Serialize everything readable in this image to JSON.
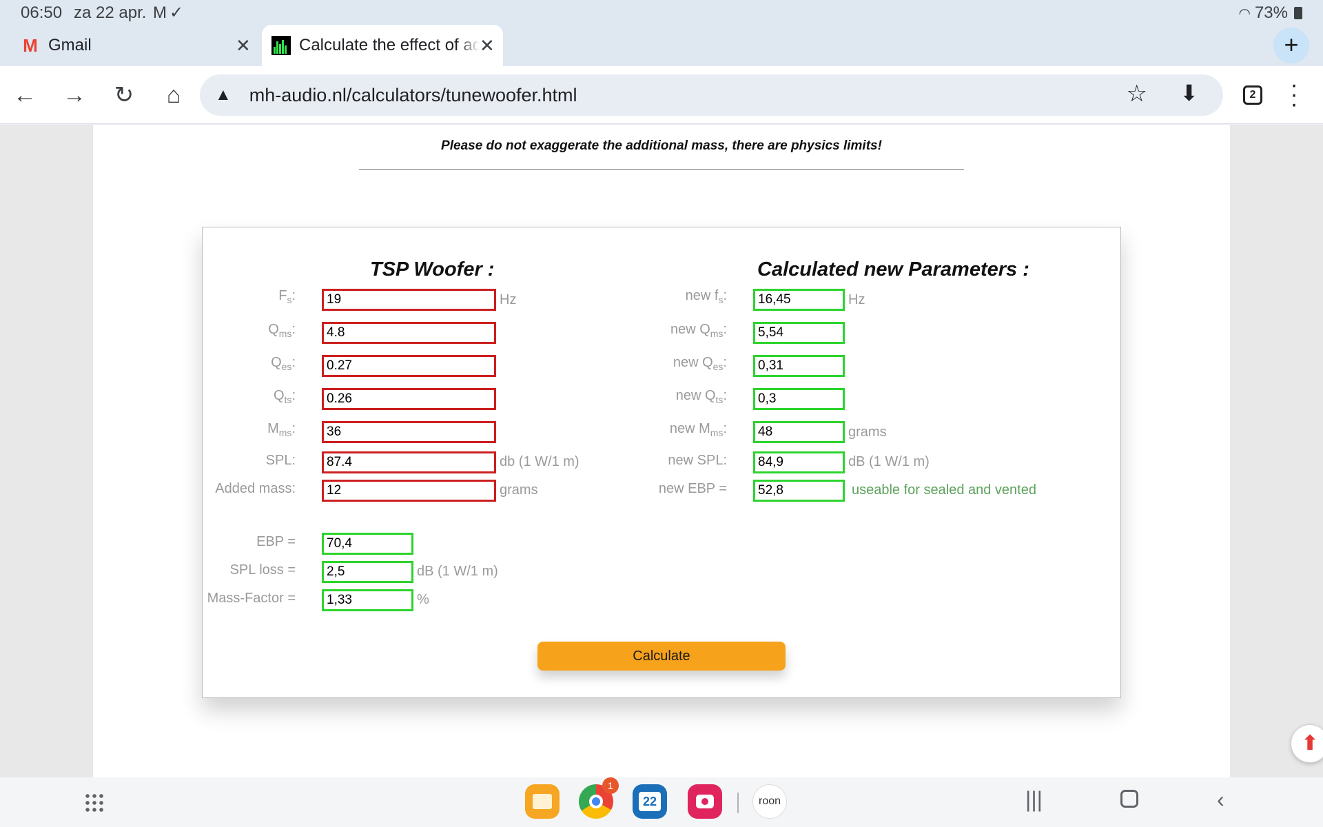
{
  "status_bar": {
    "time": "06:50",
    "date": "za 22 apr.",
    "notification_icons": [
      "gmail-notification-icon",
      "checkmark-icon"
    ],
    "battery": "73%"
  },
  "tabs": [
    {
      "label": "Gmail",
      "active": false,
      "icon": "gmail-icon"
    },
    {
      "label": "Calculate the effect of adding mass",
      "active": true,
      "icon": "graph-icon"
    }
  ],
  "tab_count": "2",
  "address_bar": {
    "url": "mh-audio.nl/calculators/tunewoofer.html"
  },
  "page": {
    "notice": "Please do not exaggerate the additional mass, there are physics limits!",
    "left_title": "TSP Woofer :",
    "right_title": "Calculated new Parameters :",
    "inputs": {
      "fs": {
        "label": "F",
        "sub": "s",
        "value": "19",
        "unit": "Hz"
      },
      "qms": {
        "label": "Q",
        "sub": "ms",
        "value": "4.8"
      },
      "qes": {
        "label": "Q",
        "sub": "es",
        "value": "0.27"
      },
      "qts": {
        "label": "Q",
        "sub": "ts",
        "value": "0.26"
      },
      "mms": {
        "label": "M",
        "sub": "ms",
        "value": "36"
      },
      "spl": {
        "label": "SPL:",
        "value": "87.4",
        "unit": "db (1 W/1 m)"
      },
      "added_mass": {
        "label": "Added mass:",
        "value": "12",
        "unit": "grams"
      }
    },
    "results_left": {
      "ebp": {
        "label": "EBP =",
        "value": "70,4"
      },
      "spl_loss": {
        "label": "SPL loss =",
        "value": "2,5",
        "unit": "dB (1 W/1 m)"
      },
      "mass_factor": {
        "label": "Mass-Factor =",
        "value": "1,33",
        "unit": "%"
      }
    },
    "results_right": {
      "new_fs": {
        "label": "new f",
        "sub": "s",
        "value": "16,45",
        "unit": "Hz"
      },
      "new_qms": {
        "label": "new Q",
        "sub": "ms",
        "value": "5,54"
      },
      "new_qes": {
        "label": "new Q",
        "sub": "es",
        "value": "0,31"
      },
      "new_qts": {
        "label": "new Q",
        "sub": "ts",
        "value": "0,3"
      },
      "new_mms": {
        "label": "new M",
        "sub": "ms",
        "value": "48",
        "unit": "grams"
      },
      "new_spl": {
        "label": "new SPL:",
        "value": "84,9",
        "unit": "dB (1 W/1 m)"
      },
      "new_ebp": {
        "label": "new EBP =",
        "value": "52,8",
        "unit": "useable for sealed and vented"
      }
    },
    "calculate_button": "Calculate"
  },
  "dock": {
    "chrome_badge": "1",
    "calendar_day": "22",
    "roon_label": "roon"
  },
  "colors": {
    "input_border": "#cc1f1f",
    "output_border": "#2cd42c",
    "button": "#f7a21b"
  }
}
